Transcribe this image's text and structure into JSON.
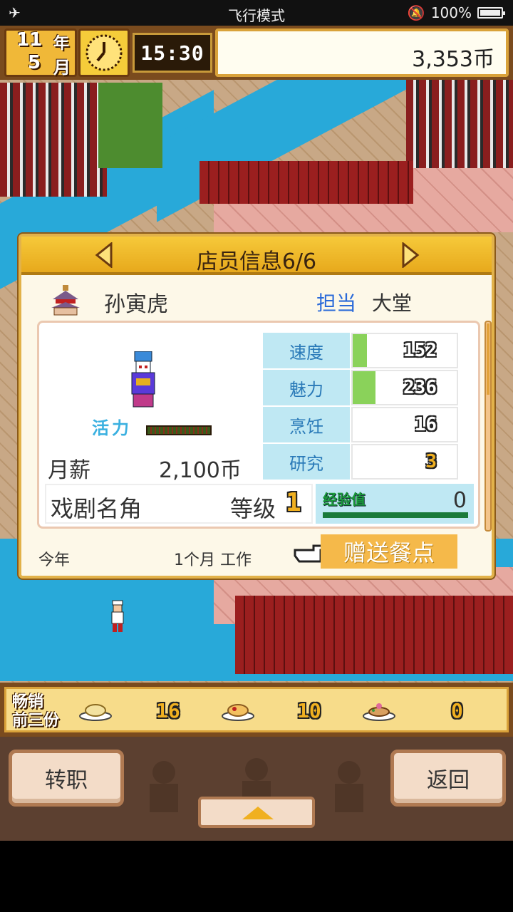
{
  "status_bar": {
    "title": "飞行模式",
    "battery": "100%"
  },
  "hud": {
    "year_num": "11",
    "year_unit": "年",
    "month_num": "5",
    "month_unit": "月",
    "time": "15:30",
    "money": "3,353币"
  },
  "dialog": {
    "title": "店员信息6/6",
    "name": "孙寅虎",
    "role_label": "担当",
    "role_value": "大堂",
    "vitality_label": "活力",
    "salary_label": "月薪",
    "salary_value": "2,100币",
    "stats": [
      {
        "label": "速度",
        "value": "152",
        "fill": 0.14
      },
      {
        "label": "魅力",
        "value": "236",
        "fill": 0.22
      },
      {
        "label": "烹饪",
        "value": "16",
        "fill": 0
      },
      {
        "label": "研究",
        "value": "3",
        "fill": 0
      }
    ],
    "job_title": "戏剧名角",
    "level_label": "等级",
    "level_value": "1",
    "exp_label": "经验值",
    "exp_value": "0",
    "year_label": "今年",
    "work_text": "1个月 工作",
    "gift_button": "赠送餐点"
  },
  "bestsellers": {
    "label_line1": "畅销",
    "label_line2": "前三份",
    "items": [
      {
        "count": "16"
      },
      {
        "count": "10"
      },
      {
        "count": "0"
      }
    ]
  },
  "buttons": {
    "left": "转职",
    "right": "返回"
  },
  "colors": {
    "accent": "#f5b94a",
    "stat_label_bg": "#bfe8f3",
    "stat_bar": "#8ad25a",
    "water": "#28a9d9"
  }
}
